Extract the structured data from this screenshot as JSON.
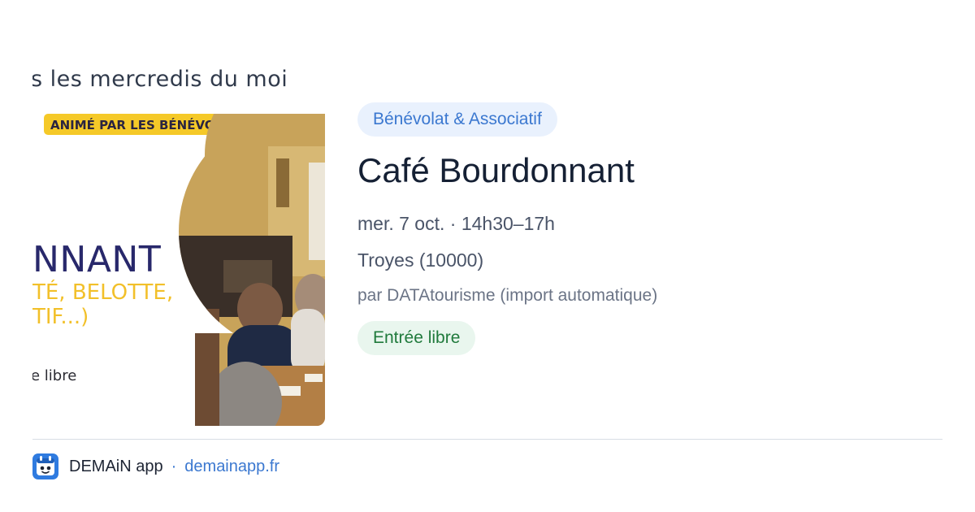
{
  "poster": {
    "line1": "s les mercredis du moi",
    "banner": "ANIMÉ PAR LES BÉNÉVOLES DU RUCHER",
    "big_title": "NNANT",
    "subtitle_line1": "TÉ, BELOTTE,",
    "subtitle_line2": "TIF...)",
    "entry_text": "e libre"
  },
  "event": {
    "category": "Bénévolat & Associatif",
    "title": "Café Bourdonnant",
    "datetime": "mer. 7 oct. · 14h30–17h",
    "location": "Troyes (10000)",
    "organizer": "par DATAtourisme (import automatique)",
    "price": "Entrée libre"
  },
  "footer": {
    "app_name": "DEMAiN app",
    "separator": "·",
    "domain": "demainapp.fr"
  },
  "colors": {
    "accent_blue": "#3b78d0",
    "tag_bg": "#e9f1fd",
    "price_bg": "#e9f6ee",
    "price_text": "#207a3c",
    "poster_yellow": "#f5c928",
    "poster_navy": "#28286b"
  },
  "icons": {
    "app_icon": "demain-app-icon"
  }
}
